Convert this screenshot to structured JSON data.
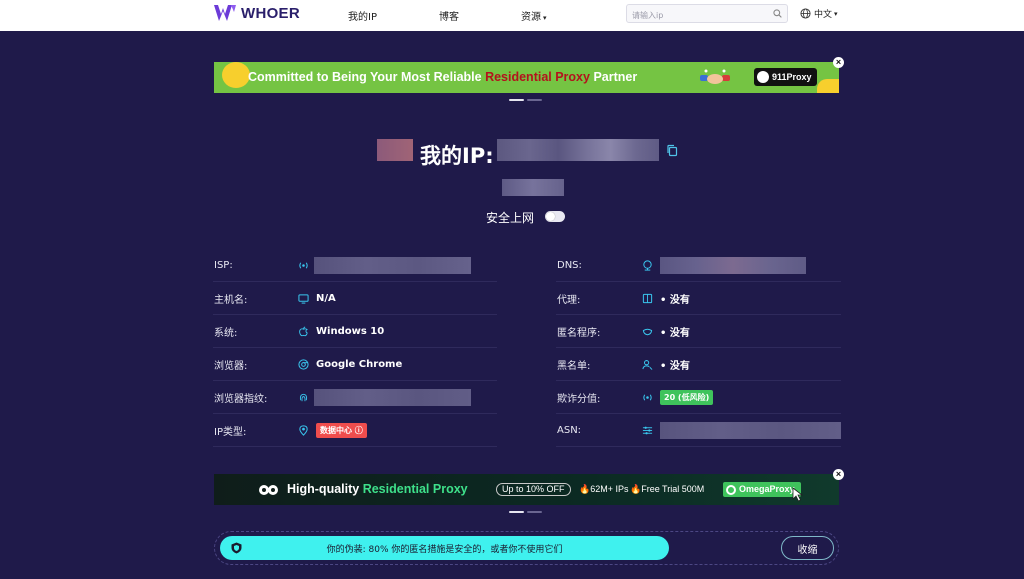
{
  "nav": {
    "logo": "WHOER",
    "links": [
      {
        "label": "我的IP"
      },
      {
        "label": "博客"
      },
      {
        "label": "资源"
      }
    ],
    "search_placeholder": "请输入ip",
    "language": "中文"
  },
  "banner_top": {
    "text_pre": "Committed to Being Your Most Reliable ",
    "text_highlight": "Residential Proxy",
    "text_post": " Partner",
    "brand": "911Proxy",
    "close": "×"
  },
  "hero": {
    "title": "我的IP:",
    "secure_label": "安全上网",
    "secure_on": false
  },
  "info_left": [
    {
      "label": "ISP:",
      "value": ""
    },
    {
      "label": "主机名:",
      "value": "N/A"
    },
    {
      "label": "系统:",
      "value": "Windows 10"
    },
    {
      "label": "浏览器:",
      "value": "Google Chrome"
    },
    {
      "label": "浏览器指纹:",
      "value": ""
    },
    {
      "label": "IP类型:",
      "value": "数据中心 ⓘ"
    }
  ],
  "info_right": [
    {
      "label": "DNS:",
      "value": ""
    },
    {
      "label": "代理:",
      "value": "• 没有"
    },
    {
      "label": "匿名程序:",
      "value": "• 没有"
    },
    {
      "label": "黑名单:",
      "value": "• 没有"
    },
    {
      "label": "欺诈分值:",
      "value": "20 (低风险)"
    },
    {
      "label": "ASN:",
      "value": ""
    }
  ],
  "banner_bottom": {
    "text_pre": "High-quality ",
    "text_highlight": "Residential Proxy",
    "off": "Up to 10% OFF",
    "feature1": "🔥62M+ IPs",
    "feature2": "🔥Free Trial 500M",
    "brand": "OmegaProxy",
    "close": "×"
  },
  "bottom_bar": {
    "message": "你的伪装: 80% 你的匿名措施是安全的，或者你不使用它们",
    "collapse": "收缩"
  },
  "colors": {
    "background": "#1f1a4a",
    "accent_cyan": "#3ff1ee",
    "badge_red": "#ef4d4d",
    "badge_green": "#3fc35c",
    "icon_cyan": "#39c6ee"
  }
}
